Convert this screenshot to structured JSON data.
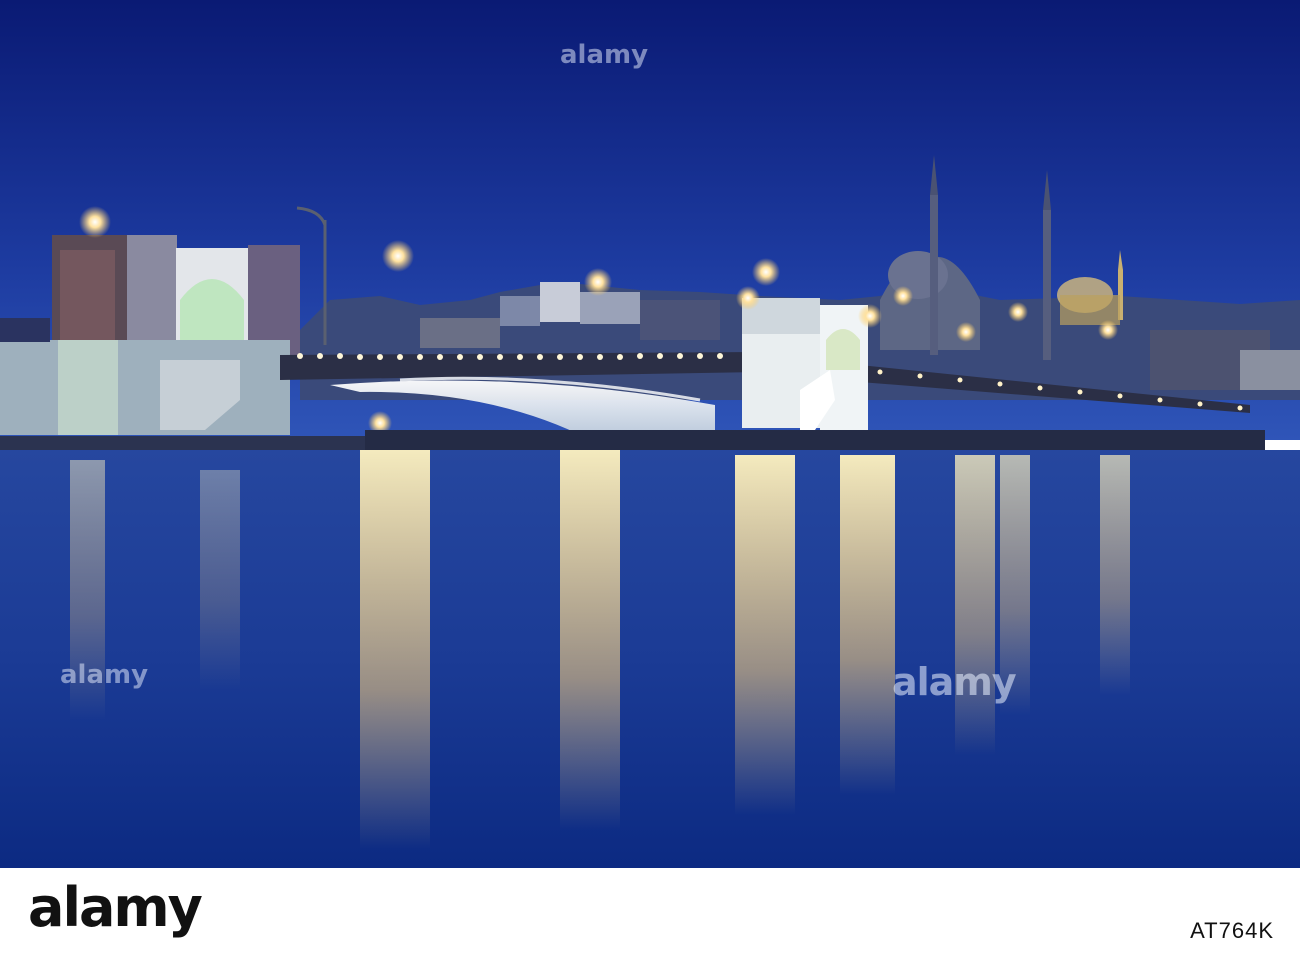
{
  "photo": {
    "subject": "night-view-galata-bridge-istanbul",
    "colors": {
      "sky_top": "#0a1e7a",
      "sky_bottom": "#2747a8",
      "water_top": "#1d3f98",
      "water_bottom": "#0b2a80",
      "light_warm": "#ffd98a",
      "light_white": "#fff7d8"
    }
  },
  "watermark": {
    "brand": "alamy",
    "image_id": "AT764K"
  }
}
